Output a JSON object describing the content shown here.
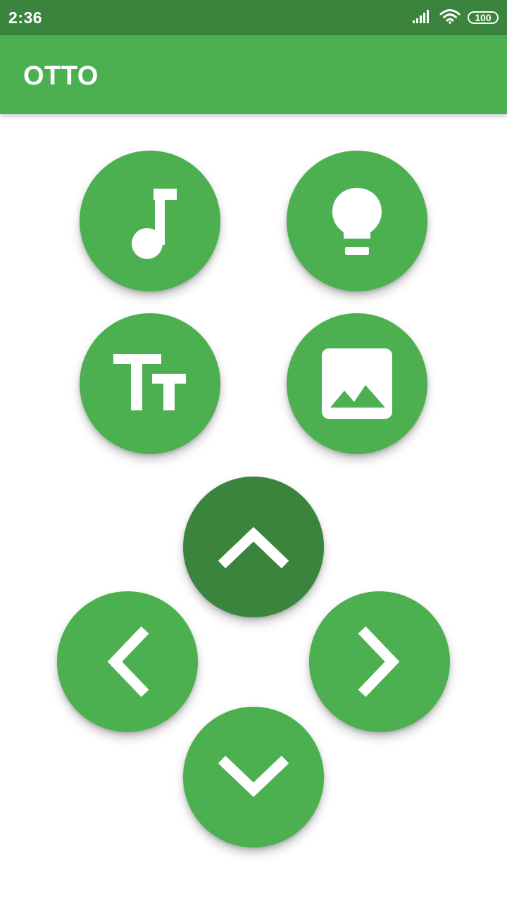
{
  "status_bar": {
    "time": "2:36",
    "battery": "100",
    "icons": [
      "signal-icon",
      "wifi-icon",
      "battery-icon"
    ]
  },
  "app_bar": {
    "title": "OTTO"
  },
  "controls": {
    "top_buttons": [
      {
        "icon": "music-note-icon"
      },
      {
        "icon": "lightbulb-icon"
      },
      {
        "icon": "text-size-icon"
      },
      {
        "icon": "image-icon"
      }
    ],
    "direction_pad": [
      {
        "icon": "chevron-up-icon",
        "state": "pressed"
      },
      {
        "icon": "chevron-left-icon"
      },
      {
        "icon": "chevron-right-icon"
      },
      {
        "icon": "chevron-down-icon"
      }
    ]
  },
  "colors": {
    "primary": "#4caf50",
    "primary_dark": "#3b843d",
    "icon": "#ffffff",
    "background": "#ffffff"
  }
}
